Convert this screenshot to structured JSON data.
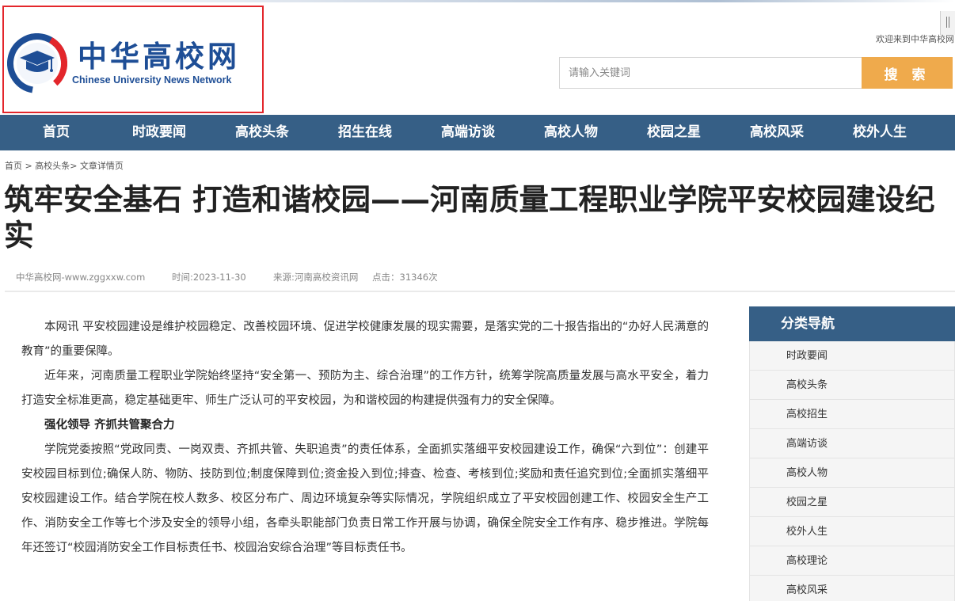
{
  "header": {
    "logo_cn": "中华高校网",
    "logo_en": "Chinese University News Network",
    "welcome": "欢迎来到中华高校网",
    "search_placeholder": "请输入关键词",
    "search_button": "搜 索"
  },
  "nav": [
    "首页",
    "时政要闻",
    "高校头条",
    "招生在线",
    "高端访谈",
    "高校人物",
    "校园之星",
    "高校风采",
    "校外人生"
  ],
  "breadcrumb": "首页 > 高校头条> 文章详情页",
  "article": {
    "title": "筑牢安全基石 打造和谐校园——河南质量工程职业学院平安校园建设纪实",
    "meta_site": "中华高校网-www.zggxxw.com",
    "meta_time": "时间:2023-11-30",
    "meta_source": "来源:河南高校资讯网",
    "meta_clicks": "点击：31346次",
    "paragraphs": [
      "本网讯 平安校园建设是维护校园稳定、改善校园环境、促进学校健康发展的现实需要，是落实党的二十报告指出的“办好人民满意的教育”的重要保障。",
      "近年来，河南质量工程职业学院始终坚持“安全第一、预防为主、综合治理”的工作方针，统筹学院高质量发展与高水平安全，着力打造安全标准更高，稳定基础更牢、师生广泛认可的平安校园，为和谐校园的构建提供强有力的安全保障。",
      "强化领导 齐抓共管聚合力",
      "学院党委按照“党政同责、一岗双责、齐抓共管、失职追责”的责任体系，全面抓实落细平安校园建设工作，确保“六到位”：创建平安校园目标到位;确保人防、物防、技防到位;制度保障到位;资金投入到位;排查、检查、考核到位;奖励和责任追究到位;全面抓实落细平安校园建设工作。结合学院在校人数多、校区分布广、周边环境复杂等实际情况，学院组织成立了平安校园创建工作、校园安全生产工作、消防安全工作等七个涉及安全的领导小组，各牵头职能部门负责日常工作开展与协调，确保全院安全工作有序、稳步推进。学院每年还签订“校园消防安全工作目标责任书、校园治安综合治理”等目标责任书。"
    ]
  },
  "sidebar": {
    "title": "分类导航",
    "items": [
      "时政要闻",
      "高校头条",
      "高校招生",
      "高端访谈",
      "高校人物",
      "校园之星",
      "校外人生",
      "高校理论",
      "高校风采"
    ]
  },
  "colors": {
    "nav_bg": "#365f86",
    "search_button": "#efaa4c",
    "logo_blue": "#1e4e96",
    "logo_red": "#e3262b"
  }
}
